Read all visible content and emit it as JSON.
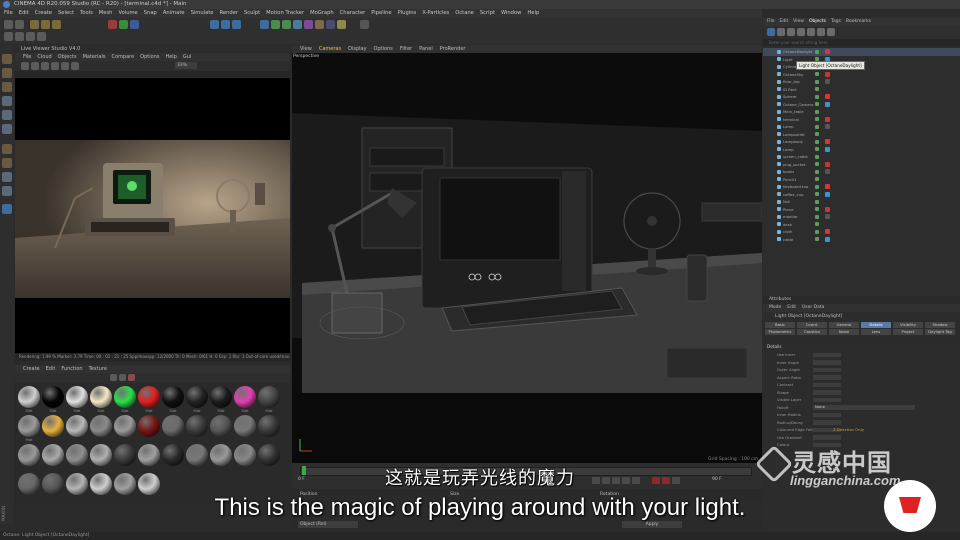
{
  "app": {
    "title": "CINEMA 4D R20.059 Studio (RC - R20) - [terminal.c4d *] - Main"
  },
  "menubar": [
    "File",
    "Edit",
    "Create",
    "Select",
    "Tools",
    "Mesh",
    "Volume",
    "Snap",
    "Animate",
    "Simulate",
    "Render",
    "Sculpt",
    "Motion Tracker",
    "MoGraph",
    "Character",
    "Pipeline",
    "Plugins",
    "X-Particles",
    "Octane",
    "Script",
    "Window",
    "Help"
  ],
  "picture_viewer": {
    "title": "Live Viewer Studio V4.0",
    "menu": [
      "File",
      "Cloud",
      "Objects",
      "Materials",
      "Compare",
      "Options",
      "Help",
      "Gui"
    ],
    "zoom": "33%",
    "bottom_info": "Rendering: 1.99 %   Marker: 3.79   Time: 00 : 01 : 21 : 25   Spp/maxspp: 12/2000   Tri: 0  Mesh: 0/61 H: 0  Grp: 1  Rtx: 1 Out-of-core used/max: 0kb/4Gb  Grey8/16: 0/0  Rgb32/64: 10/3"
  },
  "material_manager": {
    "menu": [
      "Create",
      "Edit",
      "Function",
      "Texture"
    ],
    "labels": [
      "Mat",
      "Mat",
      "Mat",
      "Mat",
      "Mat",
      "Mat",
      "Mat",
      "Mat",
      "Mat",
      "Mat",
      "Mat",
      "Mat"
    ]
  },
  "viewport": {
    "menu": [
      "View",
      "Cameras",
      "Display",
      "Options",
      "Filter",
      "Panel",
      "ProRender"
    ],
    "active_menu": "Cameras",
    "label": "Perspective",
    "grid_spacing": "Grid Spacing : 100 cm"
  },
  "timeline": {
    "start": "0 F",
    "end": "90 F"
  },
  "coord_bar": {
    "items": [
      "Position",
      "Size",
      "Rotation"
    ],
    "mode": "Object (Rel)",
    "apply": "Apply"
  },
  "object_manager": {
    "tabs": [
      "File",
      "Edit",
      "View",
      "Objects",
      "Tags",
      "Bookmarks"
    ],
    "search": "Enter your search string here",
    "tooltip": "Light Object [OctaneDaylight]",
    "rows": [
      "OctaneDaylight",
      "Light",
      "Cylinder",
      "OctaneSky",
      "floor_top",
      "ID Rect",
      "Sphere",
      "Octane_Camera",
      "Main_table",
      "terminal",
      "Lamp",
      "Lampoutlet",
      "Lampbody",
      "Lamp",
      "screen_cable",
      "plug_socket",
      "books",
      "Pencil1",
      "Keyboard.top",
      "coffee_cup",
      "Null",
      "Plane",
      "monitor",
      "desk",
      "cloth",
      "cable"
    ]
  },
  "attribute_manager": {
    "header": "Attributes",
    "menu": [
      "Mode",
      "Edit",
      "User Data"
    ],
    "object_title": "Light Object [OctaneDaylight]",
    "tabs": [
      "Basic",
      "Coord.",
      "General",
      "Details",
      "Visibility",
      "Shadow",
      "Photometric",
      "Caustics",
      "Noise",
      "Lens",
      "Project",
      "Daylight Tag"
    ],
    "active_tab": "Details",
    "section": "Details",
    "rows": [
      "Use Inner",
      "Inner Angle",
      "Outer Angle",
      "Aspect Ratio",
      "Contrast",
      "Shape",
      "Visible Layer",
      "Falloff",
      "Inner Radius",
      "Radius/Decay",
      "Coloured Edge Falloff",
      "Use Gradient",
      "Colour"
    ],
    "falloff_value": "None",
    "sub_section": "Z Direction Only"
  },
  "statusbar": "Octane:       Light Object [OctaneDaylight]",
  "subtitles": {
    "cn": "这就是玩弄光线的魔力",
    "en": "This is the magic of playing around with your light."
  },
  "watermark": {
    "cn": "灵感中国",
    "en": "lingganchina.com"
  },
  "colors": {
    "accent": "#f0c040",
    "active_tab": "#5a78a8",
    "timeline_marker": "#3aa84d"
  }
}
